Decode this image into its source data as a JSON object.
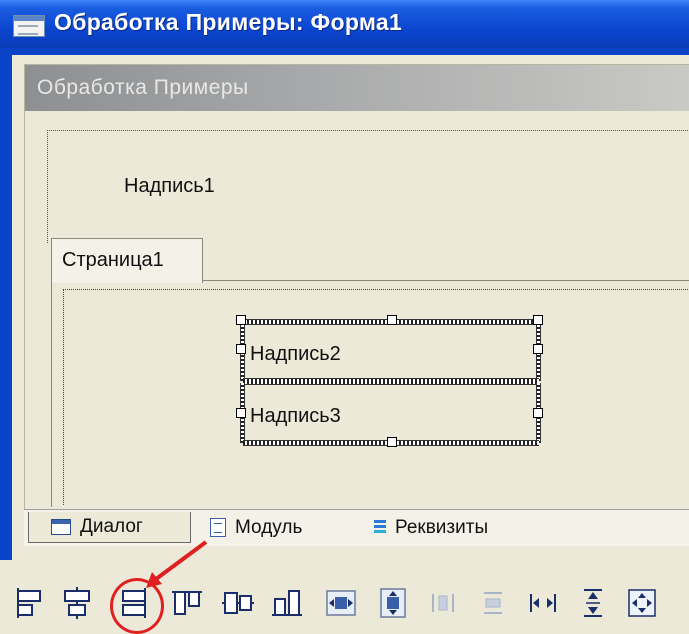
{
  "window": {
    "title": "Обработка Примеры: Форма1",
    "icon": "form-window-icon"
  },
  "form": {
    "caption": "Обработка  Примеры",
    "label1": "Надпись1",
    "page_tab": "Страница1",
    "label2": "Надпись2",
    "label3": "Надпись3"
  },
  "bottom_tabs": [
    {
      "label": "Диалог",
      "icon": "dialog-icon",
      "active": true
    },
    {
      "label": "Модуль",
      "icon": "module-icon",
      "active": false
    },
    {
      "label": "Реквизиты",
      "icon": "requisites-icon",
      "active": false
    }
  ],
  "toolbar": {
    "icons": [
      "align-left-edges-icon",
      "align-centers-vertical-icon",
      "align-right-edges-icon",
      "align-top-edges-icon",
      "align-middles-horizontal-icon",
      "align-bottom-edges-icon",
      "center-horizontally-icon",
      "center-vertically-icon",
      "space-equal-horizontal-icon",
      "space-equal-vertical-icon",
      "make-same-width-icon",
      "make-same-height-icon",
      "make-same-size-icon"
    ],
    "highlighted": "align-right-edges-icon"
  },
  "colors": {
    "titlebar": "#0b46d0",
    "form_caption": "#a9aaab",
    "face": "#ece9d8",
    "highlight_circle": "#e02020"
  }
}
